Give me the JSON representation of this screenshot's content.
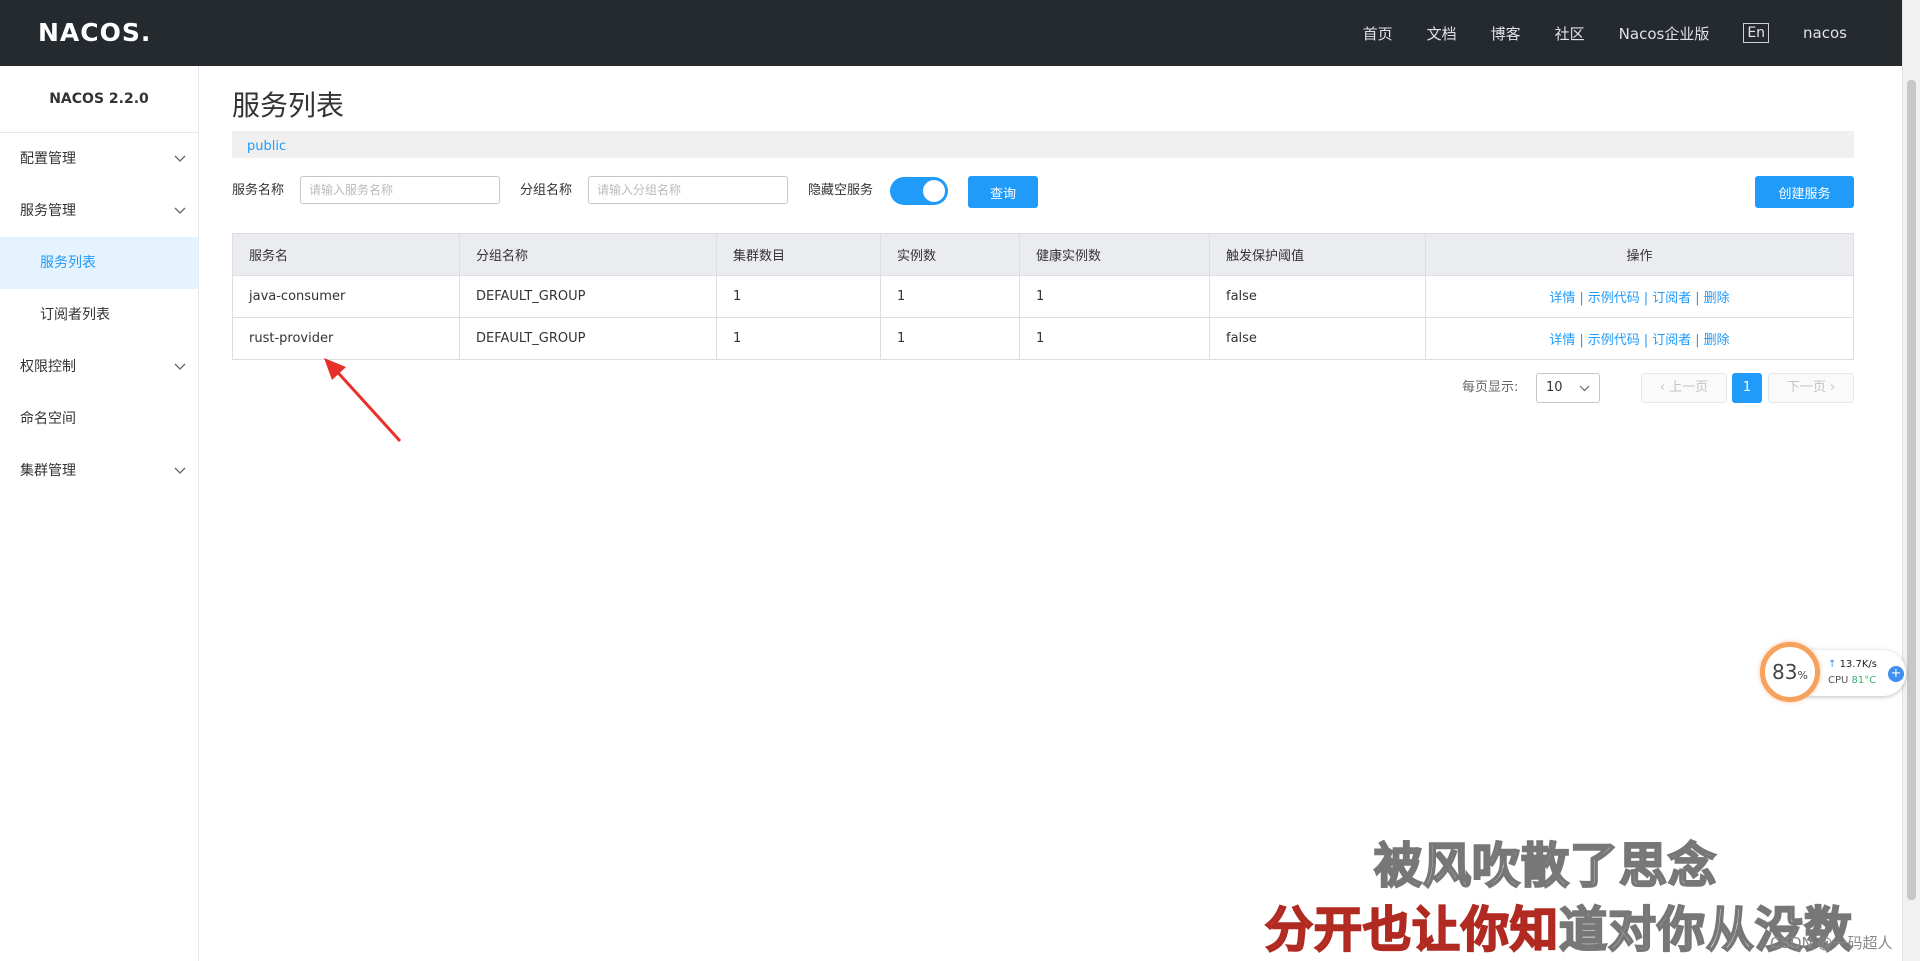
{
  "header": {
    "logo": "NACOS.",
    "nav": [
      "首页",
      "文档",
      "博客",
      "社区",
      "Nacos企业版"
    ],
    "lang": "En",
    "user": "nacos"
  },
  "sidebar": {
    "version": "NACOS 2.2.0",
    "items": [
      {
        "label": "配置管理",
        "expandable": true
      },
      {
        "label": "服务管理",
        "expandable": true
      },
      {
        "label": "服务列表",
        "sub": true,
        "active": true
      },
      {
        "label": "订阅者列表",
        "sub": true
      },
      {
        "label": "权限控制",
        "expandable": true
      },
      {
        "label": "命名空间",
        "expandable": false
      },
      {
        "label": "集群管理",
        "expandable": true
      }
    ]
  },
  "main": {
    "title": "服务列表",
    "namespace": "public",
    "search": {
      "service_label": "服务名称",
      "service_placeholder": "请输入服务名称",
      "group_label": "分组名称",
      "group_placeholder": "请输入分组名称",
      "hide_empty_label": "隐藏空服务",
      "hide_empty_on": true,
      "query_button": "查询",
      "create_button": "创建服务"
    },
    "table": {
      "headers": [
        "服务名",
        "分组名称",
        "集群数目",
        "实例数",
        "健康实例数",
        "触发保护阈值",
        "操作"
      ],
      "rows": [
        [
          "java-consumer",
          "DEFAULT_GROUP",
          "1",
          "1",
          "1",
          "false"
        ],
        [
          "rust-provider",
          "DEFAULT_GROUP",
          "1",
          "1",
          "1",
          "false"
        ]
      ],
      "ops": [
        "详情",
        "示例代码",
        "订阅者",
        "删除"
      ],
      "op_sep": "|"
    },
    "pagination": {
      "per_page_label": "每页显示:",
      "per_page_value": "10",
      "prev": "上一页",
      "current": "1",
      "next": "下一页"
    }
  },
  "widget": {
    "percent": "83",
    "percent_unit": "%",
    "net_speed": "13.7K/s",
    "cpu_label": "CPU",
    "cpu_temp": "81°C"
  },
  "overlay": {
    "lyric_line1": "被风吹散了思念",
    "lyric_line2_sung": "分开也让你知",
    "lyric_line2_unsung": "道对你从没数",
    "watermark": "CSDN @一码超人"
  },
  "colors": {
    "accent": "#209bfa",
    "topbar": "#252a2f",
    "arrow": "#e8302a"
  }
}
